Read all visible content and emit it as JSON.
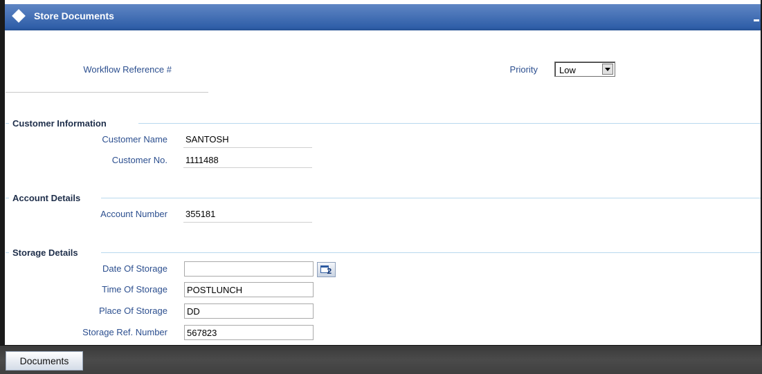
{
  "window": {
    "title": "Store Documents"
  },
  "header": {
    "workflow_ref_label": "Workflow Reference #",
    "priority_label": "Priority",
    "priority_value": "Low"
  },
  "customer": {
    "heading": "Customer Information",
    "name_label": "Customer Name",
    "name_value": "SANTOSH",
    "no_label": "Customer No.",
    "no_value": "1111488"
  },
  "account": {
    "heading": "Account Details",
    "number_label": "Account Number",
    "number_value": "355181"
  },
  "storage": {
    "heading": "Storage Details",
    "date_label": "Date Of Storage",
    "date_value": "",
    "time_label": "Time Of Storage",
    "time_value": "POSTLUNCH",
    "place_label": "Place Of Storage",
    "place_value": "DD",
    "ref_label": "Storage Ref. Number",
    "ref_value": "567823",
    "calendar_icon_number": "2"
  },
  "footer": {
    "documents_label": "Documents"
  },
  "colors": {
    "title_bar": "#2f5ea8",
    "label": "#2c4f8f",
    "section_rule": "#b8d8ee"
  }
}
